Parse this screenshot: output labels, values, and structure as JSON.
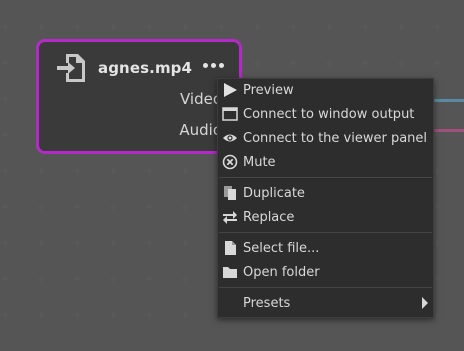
{
  "node": {
    "title": "agnes.mp4",
    "icon": "file-import-icon",
    "menu_icon": "more-horizontal-icon",
    "ports": {
      "video": "Video",
      "audio": "Audio"
    },
    "border_color": "#b42ac8"
  },
  "wires": {
    "video_color": "#5a8aa0",
    "audio_color": "#a0507a"
  },
  "context_menu": {
    "items": [
      {
        "label": "Preview",
        "icon": "play-icon"
      },
      {
        "label": "Connect to window output",
        "icon": "window-icon"
      },
      {
        "label": "Connect to the viewer panel",
        "icon": "eye-icon"
      },
      {
        "label": "Mute",
        "icon": "mute-icon"
      },
      {
        "label": "Duplicate",
        "icon": "duplicate-icon"
      },
      {
        "label": "Replace",
        "icon": "replace-icon"
      },
      {
        "label": "Select file...",
        "icon": "file-icon"
      },
      {
        "label": "Open folder",
        "icon": "folder-icon"
      },
      {
        "label": "Presets",
        "icon": "chevron-right-icon"
      }
    ]
  }
}
